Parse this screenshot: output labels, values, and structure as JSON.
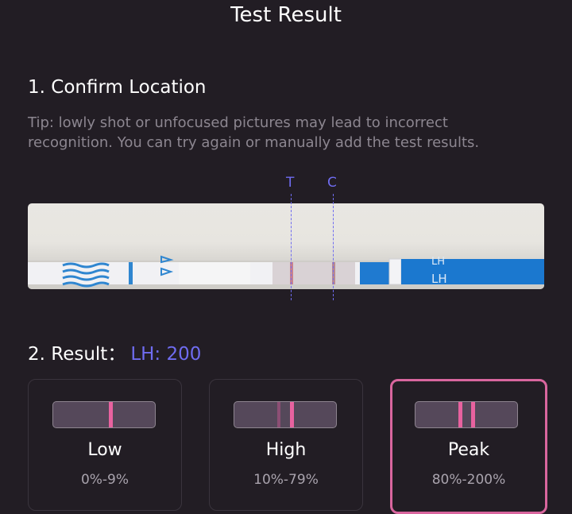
{
  "header": {
    "title": "Test Result"
  },
  "confirm_section": {
    "heading": "1. Confirm Location",
    "tip": "Tip: lowly shot or unfocused pictures may lead to incorrect recognition. You can try again or manually add the test results."
  },
  "markers": {
    "t_label": "T",
    "c_label": "C",
    "color": "#6f6cf0"
  },
  "strip_printed_text": "LH",
  "result_section": {
    "heading": "2. Result：",
    "value": "LH: 200"
  },
  "levels": [
    {
      "label": "Low",
      "range": "0%-9%",
      "selected": false
    },
    {
      "label": "High",
      "range": "10%-79%",
      "selected": false
    },
    {
      "label": "Peak",
      "range": "80%-200%",
      "selected": true
    }
  ],
  "colors": {
    "background": "#221d24",
    "accent": "#6f6cf0",
    "selected_border": "#d9669e",
    "test_line": "#e8629f"
  }
}
